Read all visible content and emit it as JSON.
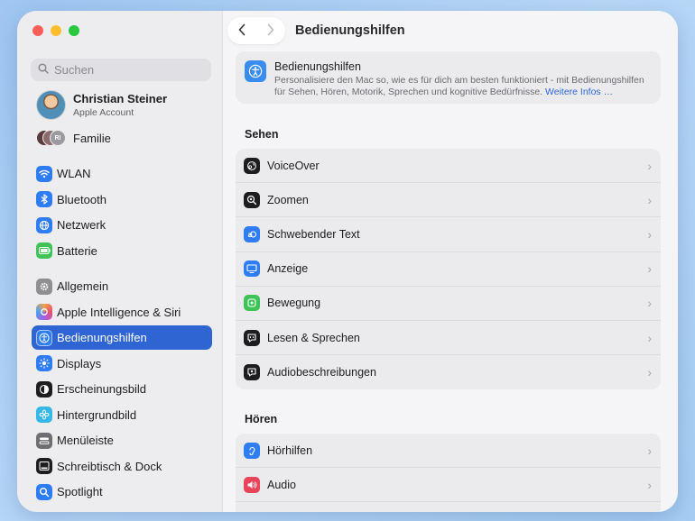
{
  "window": {
    "title": "Bedienungshilfen"
  },
  "sidebar": {
    "search_placeholder": "Suchen",
    "account": {
      "name": "Christian Steiner",
      "subtitle": "Apple Account"
    },
    "family": {
      "label": "Familie",
      "badge": "RI"
    },
    "items": [
      {
        "label": "WLAN",
        "icon": "wifi-icon",
        "color": "#2f7df6"
      },
      {
        "label": "Bluetooth",
        "icon": "bluetooth-icon",
        "color": "#2f7df6"
      },
      {
        "label": "Netzwerk",
        "icon": "globe-icon",
        "color": "#2f7df6"
      },
      {
        "label": "Batterie",
        "icon": "battery-icon",
        "color": "#3fc356"
      },
      {
        "label": "Allgemein",
        "icon": "gear-icon",
        "color": "#8e8e93"
      },
      {
        "label": "Apple Intelligence & Siri",
        "icon": "siri-icon",
        "color": "#e8856a"
      },
      {
        "label": "Bedienungshilfen",
        "icon": "accessibility-icon",
        "color": "#2f7df6",
        "active": true
      },
      {
        "label": "Displays",
        "icon": "sun-icon",
        "color": "#2f7df6"
      },
      {
        "label": "Erscheinungsbild",
        "icon": "appearance-icon",
        "color": "#1d1d1f"
      },
      {
        "label": "Hintergrundbild",
        "icon": "flower-icon",
        "color": "#35b8e8"
      },
      {
        "label": "Menüleiste",
        "icon": "menubar-icon",
        "color": "#6e6e73"
      },
      {
        "label": "Schreibtisch & Dock",
        "icon": "dock-icon",
        "color": "#1d1d1f"
      },
      {
        "label": "Spotlight",
        "icon": "magnifier-icon",
        "color": "#2f7df6"
      }
    ]
  },
  "main": {
    "header": {
      "title": "Bedienungshilfen",
      "description": "Personalisiere den Mac so, wie es für dich am besten funktioniert - mit Bedienungshilfen für Sehen, Hören, Motorik, Sprechen und kognitive Bedürfnisse.",
      "link": "Weitere Infos …"
    },
    "sections": [
      {
        "title": "Sehen",
        "rows": [
          {
            "label": "VoiceOver",
            "icon": "voiceover-icon",
            "color": "#1d1d1f"
          },
          {
            "label": "Zoomen",
            "icon": "zoom-icon",
            "color": "#1d1d1f"
          },
          {
            "label": "Schwebender Text",
            "icon": "hover-text-icon",
            "color": "#2f7df6"
          },
          {
            "label": "Anzeige",
            "icon": "display-icon",
            "color": "#2f7df6"
          },
          {
            "label": "Bewegung",
            "icon": "motion-icon",
            "color": "#3fc356"
          },
          {
            "label": "Lesen & Sprechen",
            "icon": "speech-bubble-icon",
            "color": "#1d1d1f"
          },
          {
            "label": "Audiobeschreibungen",
            "icon": "audio-description-icon",
            "color": "#1d1d1f"
          }
        ]
      },
      {
        "title": "Hören",
        "rows": [
          {
            "label": "Hörhilfen",
            "icon": "ear-icon",
            "color": "#2f7df6"
          },
          {
            "label": "Audio",
            "icon": "speaker-icon",
            "color": "#e8455a"
          }
        ]
      }
    ]
  }
}
